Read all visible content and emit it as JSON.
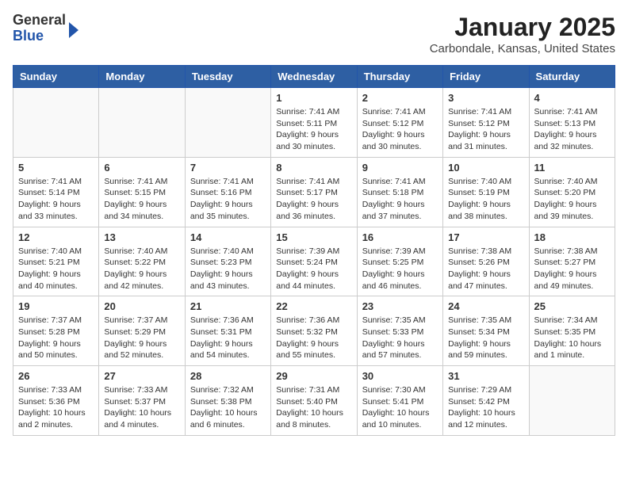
{
  "header": {
    "logo_general": "General",
    "logo_blue": "Blue",
    "month_title": "January 2025",
    "location": "Carbondale, Kansas, United States"
  },
  "weekdays": [
    "Sunday",
    "Monday",
    "Tuesday",
    "Wednesday",
    "Thursday",
    "Friday",
    "Saturday"
  ],
  "weeks": [
    [
      {
        "day": "",
        "info": ""
      },
      {
        "day": "",
        "info": ""
      },
      {
        "day": "",
        "info": ""
      },
      {
        "day": "1",
        "info": "Sunrise: 7:41 AM\nSunset: 5:11 PM\nDaylight: 9 hours\nand 30 minutes."
      },
      {
        "day": "2",
        "info": "Sunrise: 7:41 AM\nSunset: 5:12 PM\nDaylight: 9 hours\nand 30 minutes."
      },
      {
        "day": "3",
        "info": "Sunrise: 7:41 AM\nSunset: 5:12 PM\nDaylight: 9 hours\nand 31 minutes."
      },
      {
        "day": "4",
        "info": "Sunrise: 7:41 AM\nSunset: 5:13 PM\nDaylight: 9 hours\nand 32 minutes."
      }
    ],
    [
      {
        "day": "5",
        "info": "Sunrise: 7:41 AM\nSunset: 5:14 PM\nDaylight: 9 hours\nand 33 minutes."
      },
      {
        "day": "6",
        "info": "Sunrise: 7:41 AM\nSunset: 5:15 PM\nDaylight: 9 hours\nand 34 minutes."
      },
      {
        "day": "7",
        "info": "Sunrise: 7:41 AM\nSunset: 5:16 PM\nDaylight: 9 hours\nand 35 minutes."
      },
      {
        "day": "8",
        "info": "Sunrise: 7:41 AM\nSunset: 5:17 PM\nDaylight: 9 hours\nand 36 minutes."
      },
      {
        "day": "9",
        "info": "Sunrise: 7:41 AM\nSunset: 5:18 PM\nDaylight: 9 hours\nand 37 minutes."
      },
      {
        "day": "10",
        "info": "Sunrise: 7:40 AM\nSunset: 5:19 PM\nDaylight: 9 hours\nand 38 minutes."
      },
      {
        "day": "11",
        "info": "Sunrise: 7:40 AM\nSunset: 5:20 PM\nDaylight: 9 hours\nand 39 minutes."
      }
    ],
    [
      {
        "day": "12",
        "info": "Sunrise: 7:40 AM\nSunset: 5:21 PM\nDaylight: 9 hours\nand 40 minutes."
      },
      {
        "day": "13",
        "info": "Sunrise: 7:40 AM\nSunset: 5:22 PM\nDaylight: 9 hours\nand 42 minutes."
      },
      {
        "day": "14",
        "info": "Sunrise: 7:40 AM\nSunset: 5:23 PM\nDaylight: 9 hours\nand 43 minutes."
      },
      {
        "day": "15",
        "info": "Sunrise: 7:39 AM\nSunset: 5:24 PM\nDaylight: 9 hours\nand 44 minutes."
      },
      {
        "day": "16",
        "info": "Sunrise: 7:39 AM\nSunset: 5:25 PM\nDaylight: 9 hours\nand 46 minutes."
      },
      {
        "day": "17",
        "info": "Sunrise: 7:38 AM\nSunset: 5:26 PM\nDaylight: 9 hours\nand 47 minutes."
      },
      {
        "day": "18",
        "info": "Sunrise: 7:38 AM\nSunset: 5:27 PM\nDaylight: 9 hours\nand 49 minutes."
      }
    ],
    [
      {
        "day": "19",
        "info": "Sunrise: 7:37 AM\nSunset: 5:28 PM\nDaylight: 9 hours\nand 50 minutes."
      },
      {
        "day": "20",
        "info": "Sunrise: 7:37 AM\nSunset: 5:29 PM\nDaylight: 9 hours\nand 52 minutes."
      },
      {
        "day": "21",
        "info": "Sunrise: 7:36 AM\nSunset: 5:31 PM\nDaylight: 9 hours\nand 54 minutes."
      },
      {
        "day": "22",
        "info": "Sunrise: 7:36 AM\nSunset: 5:32 PM\nDaylight: 9 hours\nand 55 minutes."
      },
      {
        "day": "23",
        "info": "Sunrise: 7:35 AM\nSunset: 5:33 PM\nDaylight: 9 hours\nand 57 minutes."
      },
      {
        "day": "24",
        "info": "Sunrise: 7:35 AM\nSunset: 5:34 PM\nDaylight: 9 hours\nand 59 minutes."
      },
      {
        "day": "25",
        "info": "Sunrise: 7:34 AM\nSunset: 5:35 PM\nDaylight: 10 hours\nand 1 minute."
      }
    ],
    [
      {
        "day": "26",
        "info": "Sunrise: 7:33 AM\nSunset: 5:36 PM\nDaylight: 10 hours\nand 2 minutes."
      },
      {
        "day": "27",
        "info": "Sunrise: 7:33 AM\nSunset: 5:37 PM\nDaylight: 10 hours\nand 4 minutes."
      },
      {
        "day": "28",
        "info": "Sunrise: 7:32 AM\nSunset: 5:38 PM\nDaylight: 10 hours\nand 6 minutes."
      },
      {
        "day": "29",
        "info": "Sunrise: 7:31 AM\nSunset: 5:40 PM\nDaylight: 10 hours\nand 8 minutes."
      },
      {
        "day": "30",
        "info": "Sunrise: 7:30 AM\nSunset: 5:41 PM\nDaylight: 10 hours\nand 10 minutes."
      },
      {
        "day": "31",
        "info": "Sunrise: 7:29 AM\nSunset: 5:42 PM\nDaylight: 10 hours\nand 12 minutes."
      },
      {
        "day": "",
        "info": ""
      }
    ]
  ]
}
